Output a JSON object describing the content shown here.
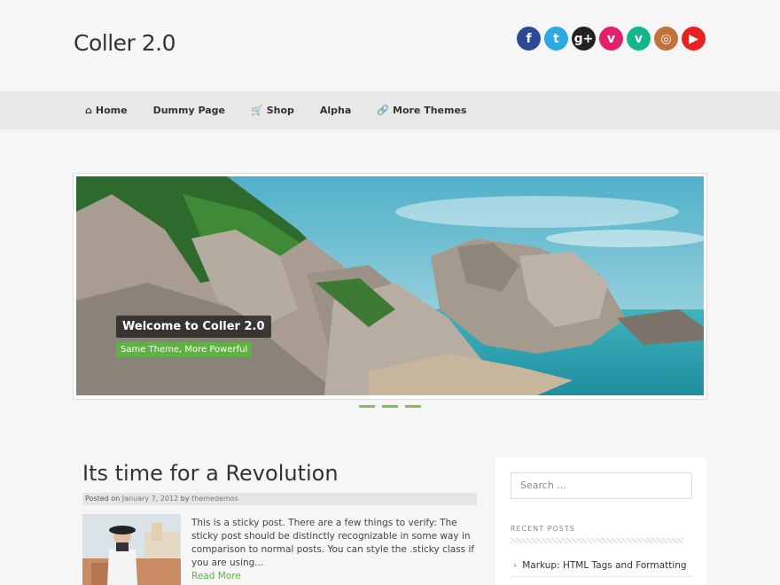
{
  "header": {
    "site_title": "Coller 2.0",
    "social": [
      {
        "name": "facebook",
        "glyph": "f",
        "color": "#2a4b93"
      },
      {
        "name": "twitter",
        "glyph": "t",
        "color": "#2ea8e1"
      },
      {
        "name": "googleplus",
        "glyph": "g+",
        "color": "#222222"
      },
      {
        "name": "vimeo",
        "glyph": "v",
        "color": "#e0226a"
      },
      {
        "name": "vine",
        "glyph": "v",
        "color": "#12b78d"
      },
      {
        "name": "instagram",
        "glyph": "◎",
        "color": "#c0723c"
      },
      {
        "name": "youtube",
        "glyph": "▶",
        "color": "#e82223"
      }
    ]
  },
  "nav": {
    "items": [
      {
        "label": "Home",
        "icon": "home-icon",
        "glyph": "⌂"
      },
      {
        "label": "Dummy Page",
        "icon": "",
        "glyph": ""
      },
      {
        "label": "Shop",
        "icon": "cart-icon",
        "glyph": "🛒"
      },
      {
        "label": "Alpha",
        "icon": "",
        "glyph": ""
      },
      {
        "label": "More Themes",
        "icon": "link-icon",
        "glyph": "🔗"
      }
    ]
  },
  "slider": {
    "caption_title": "Welcome to Coller 2.0",
    "caption_subtitle": "Same Theme, More Powerful",
    "accent": "#5fb143"
  },
  "post": {
    "title": "Its time for a Revolution",
    "meta_prefix": "Posted on",
    "date": "January 7, 2012",
    "by": "by",
    "author": "themedemos",
    "excerpt": "This is a sticky post. There are a few things to verify: The sticky post should be distinctly recognizable in some way in comparison to normal posts. You can style the .sticky class if you are using...",
    "read_more": "Read More"
  },
  "sidebar": {
    "search_placeholder": "Search ...",
    "recent_title": "RECENT POSTS",
    "recent_posts": [
      "Markup: HTML Tags and Formatting"
    ]
  }
}
